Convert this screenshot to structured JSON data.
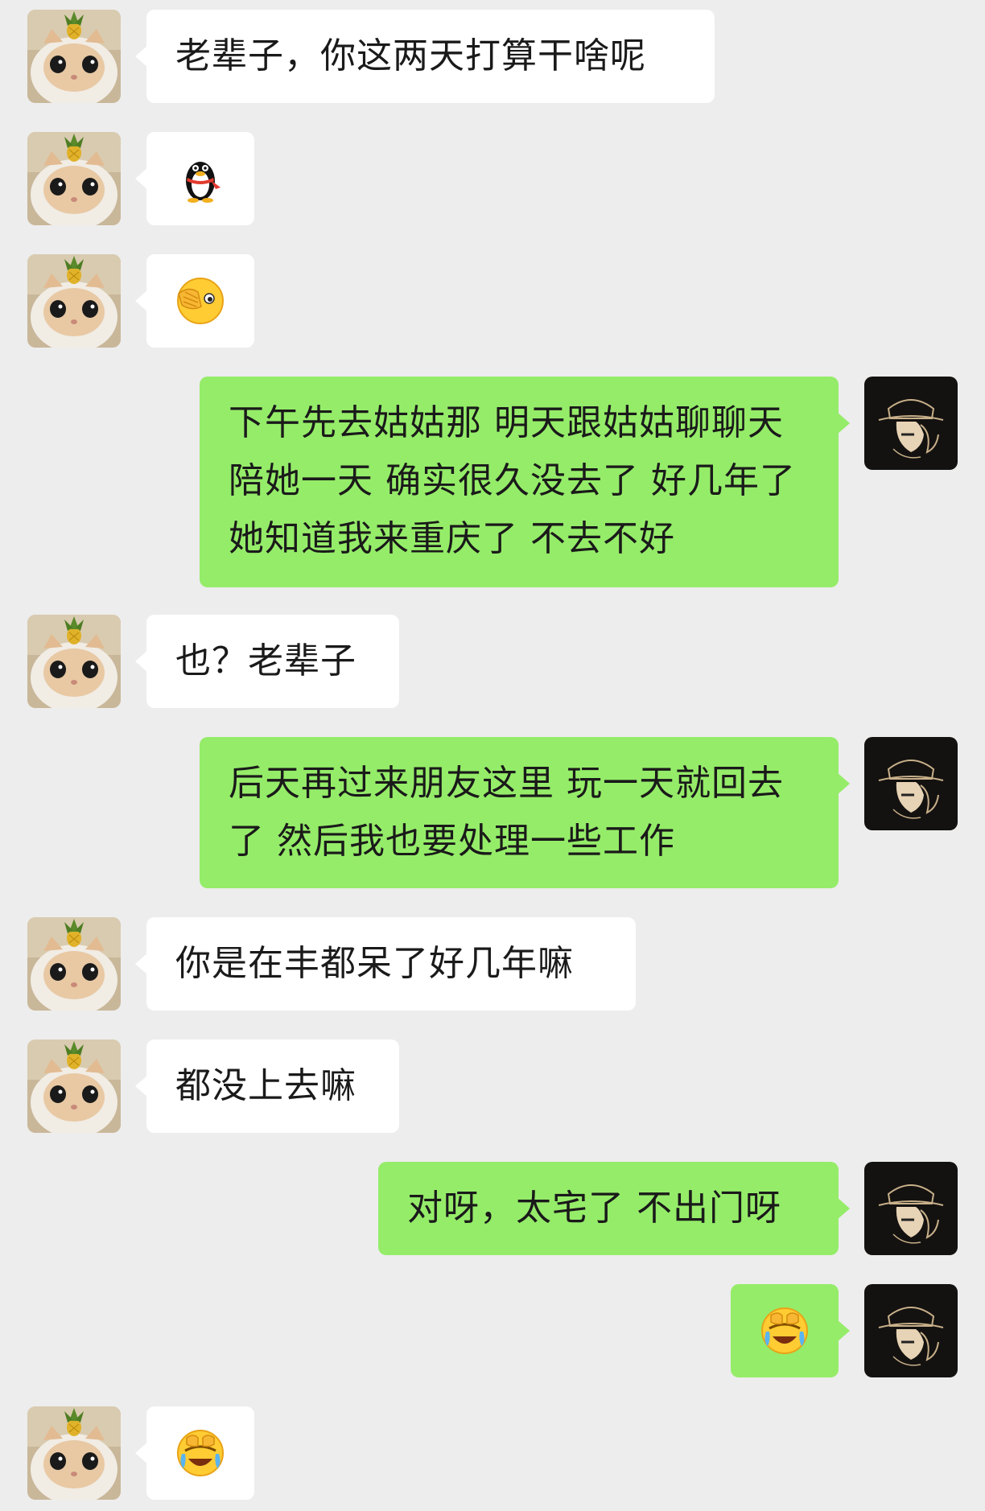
{
  "messages": [
    {
      "side": "left",
      "type": "text",
      "text": "老辈子，你这两天打算干啥呢"
    },
    {
      "side": "left",
      "type": "emoji",
      "emoji": "penguin-icon"
    },
    {
      "side": "left",
      "type": "emoji",
      "emoji": "facepalm-peek-icon"
    },
    {
      "side": "right",
      "type": "text",
      "text": "下午先去姑姑那 明天跟姑姑聊聊天 陪她一天 确实很久没去了 好几年了 她知道我来重庆了 不去不好"
    },
    {
      "side": "left",
      "type": "text",
      "text": "也？老辈子"
    },
    {
      "side": "right",
      "type": "text",
      "text": "后天再过来朋友这里 玩一天就回去了 然后我也要处理一些工作"
    },
    {
      "side": "left",
      "type": "text",
      "text": "你是在丰都呆了好几年嘛"
    },
    {
      "side": "left",
      "type": "text",
      "text": "都没上去嘛"
    },
    {
      "side": "right",
      "type": "text",
      "text": "对呀，太宅了 不出门呀"
    },
    {
      "side": "right",
      "type": "emoji",
      "emoji": "laugh-cry-cover-icon"
    },
    {
      "side": "left",
      "type": "emoji",
      "emoji": "laugh-cry-cover-icon"
    }
  ],
  "colors": {
    "background": "#ededed",
    "bubble_left": "#ffffff",
    "bubble_right": "#95ec69",
    "text": "#1a1a1a"
  },
  "avatars": {
    "left": "cat-pineapple-avatar",
    "right": "hat-man-avatar"
  }
}
